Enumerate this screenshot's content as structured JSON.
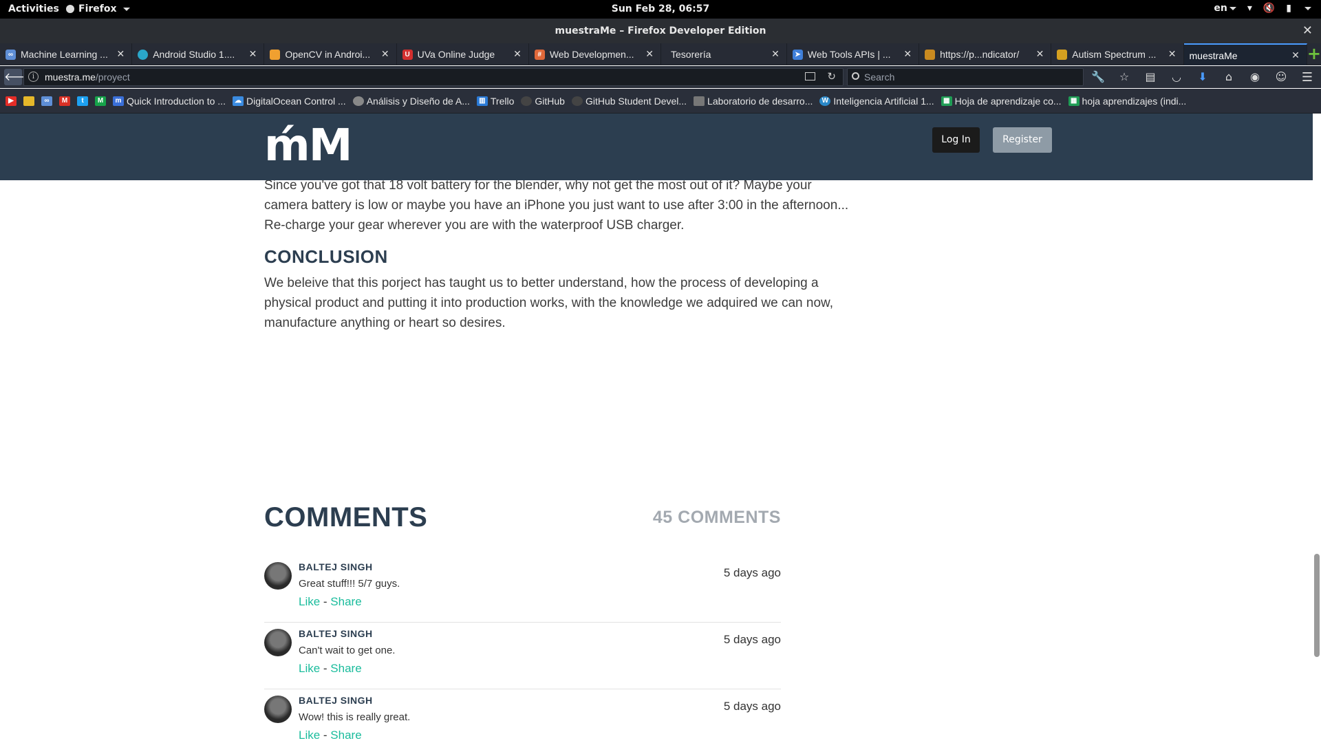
{
  "topbar": {
    "activities": "Activities",
    "app_menu": "Firefox",
    "clock": "Sun Feb 28, 06:57",
    "lang": "en"
  },
  "window": {
    "title": "muestraMe – Firefox Developer Edition"
  },
  "tabs": [
    {
      "label": "Machine Learning ...",
      "favicon_color": "#5e8ed6"
    },
    {
      "label": "Android Studio 1....",
      "favicon_color": "#2aa6c9"
    },
    {
      "label": "OpenCV in Androi...",
      "favicon_color": "#f0a030"
    },
    {
      "label": "UVa Online Judge",
      "favicon_color": "#d32f2f"
    },
    {
      "label": "Web Developmen...",
      "favicon_color": "#e0683a"
    },
    {
      "label": "Tesorería",
      "favicon_color": ""
    },
    {
      "label": "Web Tools APIs | ...",
      "favicon_color": "#3f7fd9"
    },
    {
      "label": "https://p...ndicator/",
      "favicon_color": "#c98a20"
    },
    {
      "label": "Autism Spectrum ...",
      "favicon_color": "#d4a020"
    },
    {
      "label": "muestraMe",
      "favicon_color": ""
    }
  ],
  "navbar": {
    "url_host": "muestra.me",
    "url_path": "/proyect",
    "search_placeholder": "Search"
  },
  "bookmarks": [
    {
      "label": "Quick Introduction to ...",
      "color": "#3a6fd8"
    },
    {
      "label": "DigitalOcean Control ...",
      "color": "#3a8be0"
    },
    {
      "label": "Análisis y Diseño de A...",
      "color": "#888888"
    },
    {
      "label": "Trello",
      "color": "#2a7ad6"
    },
    {
      "label": "GitHub",
      "color": "#444444"
    },
    {
      "label": "GitHub Student Devel...",
      "color": "#444444"
    },
    {
      "label": "Laboratorio de desarro...",
      "color": "#777777"
    },
    {
      "label": "Inteligencia Artificial 1...",
      "color": "#2a88c8"
    },
    {
      "label": "Hoja de aprendizaje co...",
      "color": "#1f9d55"
    },
    {
      "label": "hoja aprendizajes (indi...",
      "color": "#1f9d55"
    }
  ],
  "site": {
    "logo": "ḿM",
    "login": "Log In",
    "register": "Register"
  },
  "article": {
    "paragraph1": "Since you've got that 18 volt battery for the blender, why not get the most out of it? Maybe your camera battery is low or maybe you have an iPhone you just want to use after 3:00 in the afternoon... Re-charge your gear wherever you are with the waterproof USB charger.",
    "conclusion_heading": "CONCLUSION",
    "paragraph2": "We beleive that this porject has taught us to better understand, how the process of developing a physical product and putting it into production works, with the knowledge we adquired we can now, manufacture anything or heart so desires."
  },
  "comments": {
    "title": "COMMENTS",
    "count": "45 COMMENTS",
    "items": [
      {
        "author": "BALTEJ SINGH",
        "text": "Great stuff!!! 5/7 guys.",
        "like": "Like",
        "sep": " - ",
        "share": "Share",
        "time": "5 days ago"
      },
      {
        "author": "BALTEJ SINGH",
        "text": "Can't wait to get one.",
        "like": "Like",
        "sep": " - ",
        "share": "Share",
        "time": "5 days ago"
      },
      {
        "author": "BALTEJ SINGH",
        "text": "Wow! this is really great.",
        "like": "Like",
        "sep": " - ",
        "share": "Share",
        "time": "5 days ago"
      }
    ]
  },
  "colors": {
    "header_bg": "#2c3e50",
    "link": "#1abc9c",
    "muted": "#a3a9b0"
  }
}
